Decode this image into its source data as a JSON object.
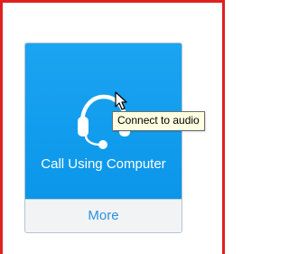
{
  "card": {
    "action_label": "Call Using Computer",
    "more_label": "More",
    "icon": "headset-icon"
  },
  "tooltip": {
    "text": "Connect to audio"
  },
  "colors": {
    "frame_border": "#e02020",
    "tile_blue": "#1aa4f1",
    "more_text": "#2a93e0",
    "tooltip_bg": "#ffffe1"
  }
}
